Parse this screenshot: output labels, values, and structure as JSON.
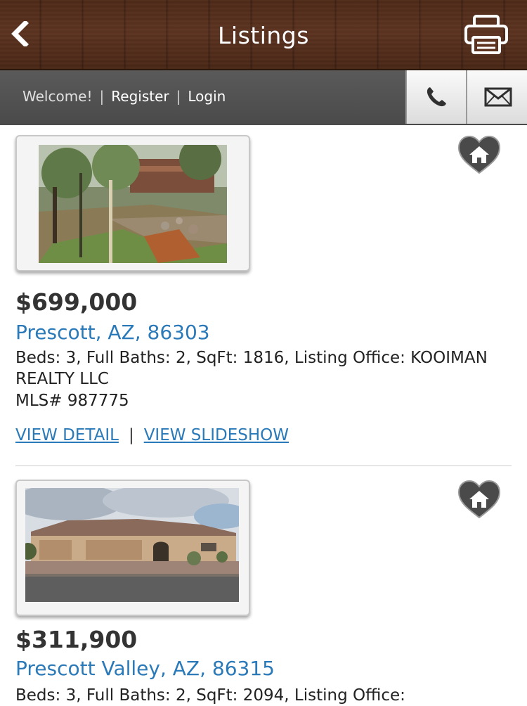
{
  "header": {
    "title": "Listings",
    "back_icon": "chevron-left-icon",
    "print_icon": "printer-icon"
  },
  "welcome_bar": {
    "welcome_text": "Welcome!",
    "separator": "|",
    "register_label": "Register",
    "login_label": "Login",
    "phone_icon": "phone-icon",
    "mail_icon": "envelope-icon"
  },
  "colors": {
    "link_blue": "#2a79b8",
    "wood_brown": "#5d3320",
    "bar_gray": "#4f4f4f",
    "heart_gray": "#4a4a4a"
  },
  "listings": [
    {
      "price": "$699,000",
      "city": "Prescott, AZ, 86303",
      "details": "Beds: 3, Full Baths: 2, SqFt: 1816, Listing Office: KOOIMAN REALTY LLC",
      "mls": "MLS# 987775",
      "view_detail_label": "VIEW DETAIL",
      "view_slideshow_label": "VIEW SLIDESHOW",
      "separator": "|",
      "favorite_icon": "heart-house-icon"
    },
    {
      "price": "$311,900",
      "city": "Prescott Valley, AZ, 86315",
      "details": "Beds: 3, Full Baths: 2, SqFt: 2094, Listing Office:",
      "favorite_icon": "heart-house-icon"
    }
  ]
}
